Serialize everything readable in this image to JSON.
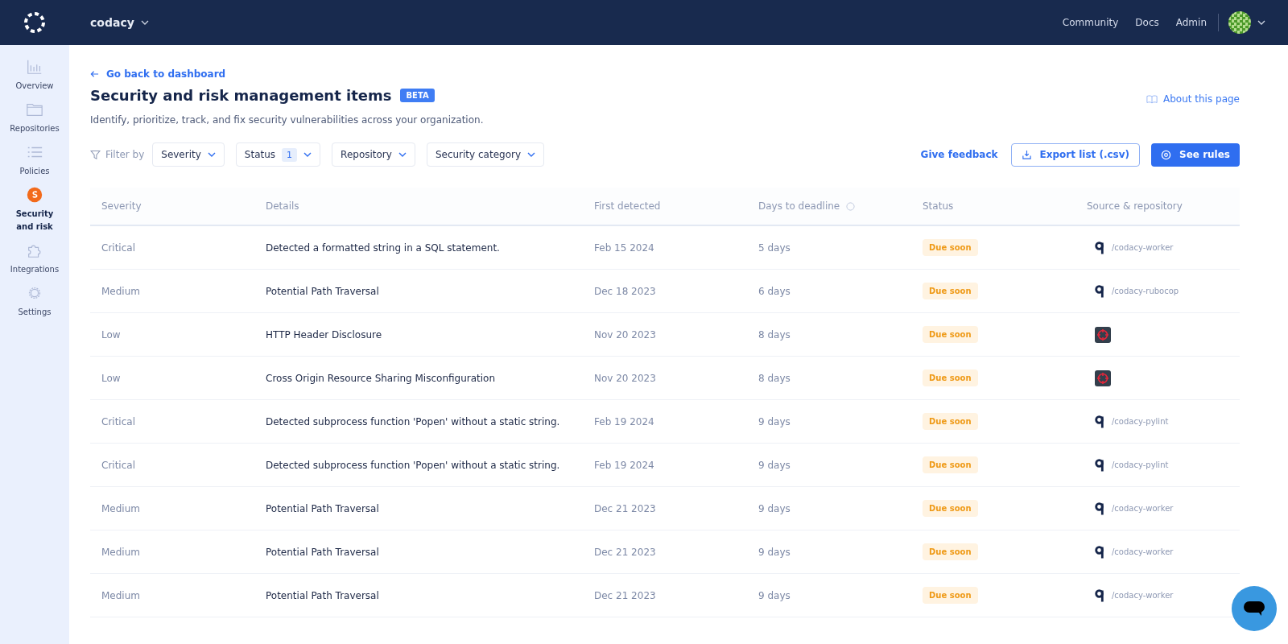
{
  "topbar": {
    "org": "codacy",
    "links": [
      "Community",
      "Docs",
      "Admin"
    ]
  },
  "sidebar": {
    "items": [
      {
        "label": "Overview",
        "selected": false
      },
      {
        "label": "Repositories",
        "selected": false
      },
      {
        "label": "Policies",
        "selected": false
      },
      {
        "label": "Security and risk",
        "selected": true
      },
      {
        "label": "Integrations",
        "selected": false
      },
      {
        "label": "Settings",
        "selected": false
      }
    ]
  },
  "header": {
    "back_link": "Go back to dashboard",
    "title": "Security and risk management items",
    "badge": "BETA",
    "about_link": "About this page",
    "description": "Identify, prioritize, track, and fix security vulnerabilities across your organization."
  },
  "filters": {
    "label": "Filter by",
    "items": [
      {
        "label": "Severity"
      },
      {
        "label": "Status",
        "count": "1"
      },
      {
        "label": "Repository"
      },
      {
        "label": "Security category"
      }
    ]
  },
  "actions": {
    "feedback": "Give feedback",
    "export": "Export list (.csv)",
    "rules": "See rules"
  },
  "table": {
    "columns": [
      "Severity",
      "Details",
      "First detected",
      "Days to deadline",
      "Status",
      "Source & repository"
    ],
    "rows": [
      {
        "severity": "Critical",
        "details": "Detected a formatted string in a SQL statement.",
        "first_detected": "Feb 15 2024",
        "days": "5 days",
        "status": "Due soon",
        "source": {
          "kind": "q",
          "repo": "/codacy-worker"
        }
      },
      {
        "severity": "Medium",
        "details": "Potential Path Traversal",
        "first_detected": "Dec 18 2023",
        "days": "6 days",
        "status": "Due soon",
        "source": {
          "kind": "q",
          "repo": "/codacy-rubocop"
        }
      },
      {
        "severity": "Low",
        "details": "HTTP Header Disclosure",
        "first_detected": "Nov 20 2023",
        "days": "8 days",
        "status": "Due soon",
        "source": {
          "kind": "target"
        }
      },
      {
        "severity": "Low",
        "details": "Cross Origin Resource Sharing Misconfiguration",
        "first_detected": "Nov 20 2023",
        "days": "8 days",
        "status": "Due soon",
        "source": {
          "kind": "target"
        }
      },
      {
        "severity": "Critical",
        "details": "Detected subprocess function 'Popen' without a static string.",
        "first_detected": "Feb 19 2024",
        "days": "9 days",
        "status": "Due soon",
        "source": {
          "kind": "q",
          "repo": "/codacy-pylint"
        }
      },
      {
        "severity": "Critical",
        "details": "Detected subprocess function 'Popen' without a static string.",
        "first_detected": "Feb 19 2024",
        "days": "9 days",
        "status": "Due soon",
        "source": {
          "kind": "q",
          "repo": "/codacy-pylint"
        }
      },
      {
        "severity": "Medium",
        "details": "Potential Path Traversal",
        "first_detected": "Dec 21 2023",
        "days": "9 days",
        "status": "Due soon",
        "source": {
          "kind": "q",
          "repo": "/codacy-worker"
        }
      },
      {
        "severity": "Medium",
        "details": "Potential Path Traversal",
        "first_detected": "Dec 21 2023",
        "days": "9 days",
        "status": "Due soon",
        "source": {
          "kind": "q",
          "repo": "/codacy-worker"
        }
      },
      {
        "severity": "Medium",
        "details": "Potential Path Traversal",
        "first_detected": "Dec 21 2023",
        "days": "9 days",
        "status": "Due soon",
        "source": {
          "kind": "q",
          "repo": "/codacy-worker"
        }
      }
    ]
  }
}
